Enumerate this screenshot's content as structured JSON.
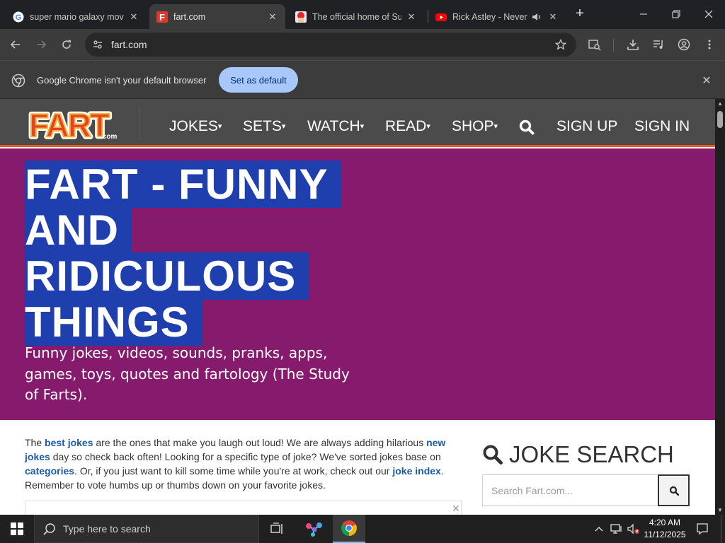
{
  "browser": {
    "tabs": [
      {
        "title": "super mario galaxy mov",
        "favicon": "google-icon",
        "active": false
      },
      {
        "title": "fart.com",
        "favicon": "fart-favicon",
        "active": true
      },
      {
        "title": "The official home of Sup",
        "favicon": "mario-favicon",
        "active": false
      },
      {
        "title": "Rick Astley - Never",
        "favicon": "youtube-icon",
        "active": false,
        "audio": true
      }
    ],
    "new_tab_label": "+",
    "url": "fart.com",
    "infobar": {
      "message": "Google Chrome isn't your default browser",
      "button_label": "Set as default"
    }
  },
  "site": {
    "logo_text": "FART",
    "logo_suffix": ".com",
    "nav": [
      {
        "label": "JOKES",
        "dropdown": true
      },
      {
        "label": "SETS",
        "dropdown": true
      },
      {
        "label": "WATCH",
        "dropdown": true
      },
      {
        "label": "READ",
        "dropdown": true
      },
      {
        "label": "SHOP",
        "dropdown": true
      }
    ],
    "nav_caret": "▾",
    "sign_up": "SIGN UP",
    "sign_in": "SIGN IN",
    "hero": {
      "title_lines": [
        "FART - FUNNY",
        "AND",
        "RIDICULOUS",
        "THINGS"
      ],
      "subtitle": "Funny jokes, videos, sounds, pranks, apps, games, toys, quotes and fartology (The Study of Farts)."
    },
    "intro": {
      "t1": "The ",
      "l1": "best jokes",
      "t2": " are the ones that make you laugh out loud! We are always adding hilarious ",
      "l2": "new jokes",
      "t3": " day so check back often! Looking for a specific type of joke?  We've sorted jokes base on ",
      "l3": "categories",
      "t4": ".  Or, if you just want to kill some time while you're at work, check out our ",
      "l4": "joke index",
      "t5": ". Remember to vote humbs up or thumbs down on your favorite jokes."
    },
    "joke_search": {
      "heading": "JOKE SEARCH",
      "placeholder": "Search Fart.com..."
    },
    "colors": {
      "header_bg": "#4b4b4b",
      "header_accent": "#f05a22",
      "hero_bg": "#861a6c",
      "title_highlight": "#1f3fae",
      "link": "#1a5aa8"
    }
  },
  "taskbar": {
    "search_placeholder": "Type here to search",
    "time": "4:20 AM",
    "date": "11/12/2025"
  }
}
